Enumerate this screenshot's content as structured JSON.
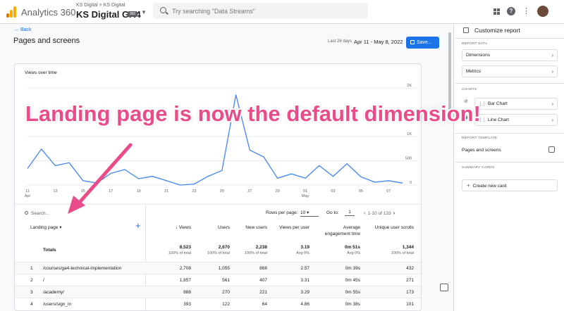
{
  "app": {
    "name": "Analytics 360",
    "breadcrumb": "KS Digital > KS Digital",
    "property": "KS Digital GA4",
    "property_badge": "360",
    "search_placeholder": "Try searching \"Data Streams\""
  },
  "header": {
    "back": "Back",
    "title": "Pages and screens",
    "date_label": "Last 28 days",
    "date_range": "Apr 11 - May 8, 2022",
    "save": "Save..."
  },
  "chart": {
    "title": "Views over time",
    "y_ticks": [
      "2K",
      "1K",
      "500",
      "0"
    ],
    "x_ticks": [
      "11",
      "13",
      "15",
      "17",
      "19",
      "21",
      "23",
      "25",
      "27",
      "29",
      "01",
      "03",
      "05",
      "07"
    ],
    "x_month_labels": [
      "Apr",
      "May"
    ]
  },
  "chart_data": {
    "type": "line",
    "title": "Views over time",
    "xlabel": "",
    "ylabel": "",
    "x": [
      "Apr 11",
      "Apr 12",
      "Apr 13",
      "Apr 14",
      "Apr 15",
      "Apr 16",
      "Apr 17",
      "Apr 18",
      "Apr 19",
      "Apr 20",
      "Apr 21",
      "Apr 22",
      "Apr 23",
      "Apr 24",
      "Apr 25",
      "Apr 26",
      "Apr 27",
      "Apr 28",
      "Apr 29",
      "Apr 30",
      "May 1",
      "May 2",
      "May 3",
      "May 4",
      "May 5",
      "May 6",
      "May 7",
      "May 8"
    ],
    "series": [
      {
        "values": [
          340,
          740,
          400,
          460,
          90,
          40,
          240,
          320,
          130,
          180,
          90,
          0,
          20,
          180,
          300,
          1860,
          720,
          580,
          140,
          230,
          140,
          400,
          180,
          440,
          170,
          60,
          90,
          40
        ]
      }
    ],
    "ylim": [
      0,
      2000
    ],
    "color": "#4285f4",
    "grid": true
  },
  "table": {
    "search_placeholder": "Search...",
    "rows_per_page_label": "Rows per page:",
    "rows_per_page": "10",
    "goto_label": "Go to:",
    "goto_value": "1",
    "pagination": "1-10 of 133",
    "dimension": "Landing page",
    "columns": [
      {
        "label": "↓ Views"
      },
      {
        "label": "Users"
      },
      {
        "label": "New users"
      },
      {
        "label": "Views per user"
      },
      {
        "label": "Average engagement time"
      },
      {
        "label": "Unique user scrolls"
      }
    ],
    "totals_label": "Totals",
    "totals": [
      {
        "value": "8,523",
        "sub": "100% of total"
      },
      {
        "value": "2,670",
        "sub": "100% of total"
      },
      {
        "value": "2,238",
        "sub": "100% of total"
      },
      {
        "value": "3.19",
        "sub": "Avg 0%"
      },
      {
        "value": "0m 51s",
        "sub": "Avg 0%"
      },
      {
        "value": "1,344",
        "sub": "100% of total"
      }
    ],
    "rows": [
      {
        "idx": "1",
        "page": "/courses/ga4-technical-implementation",
        "cells": [
          "2,708",
          "1,055",
          "868",
          "2.57",
          "0m 39s",
          "432"
        ]
      },
      {
        "idx": "2",
        "page": "/",
        "cells": [
          "1,857",
          "561",
          "407",
          "3.31",
          "0m 45s",
          "271"
        ]
      },
      {
        "idx": "3",
        "page": "/academy/",
        "cells": [
          "888",
          "270",
          "221",
          "3.29",
          "0m 55s",
          "173"
        ]
      },
      {
        "idx": "4",
        "page": "/users/sign_in",
        "cells": [
          "393",
          "122",
          "64",
          "4.86",
          "0m 38s",
          "101"
        ]
      }
    ]
  },
  "panel": {
    "title": "Customize report",
    "report_data": "REPORT DATA",
    "dimensions": "Dimensions",
    "metrics": "Metrics",
    "charts": "CHARTS",
    "bar_chart": "Bar Chart",
    "line_chart": "Line Chart",
    "report_template": "REPORT TEMPLATE",
    "template_name": "Pages and screens",
    "summary_cards": "SUMMARY CARDS",
    "create_card": "Create new card"
  },
  "annotation": {
    "text": "Landing page is now the default dimension!",
    "color": "#ea4c89"
  }
}
